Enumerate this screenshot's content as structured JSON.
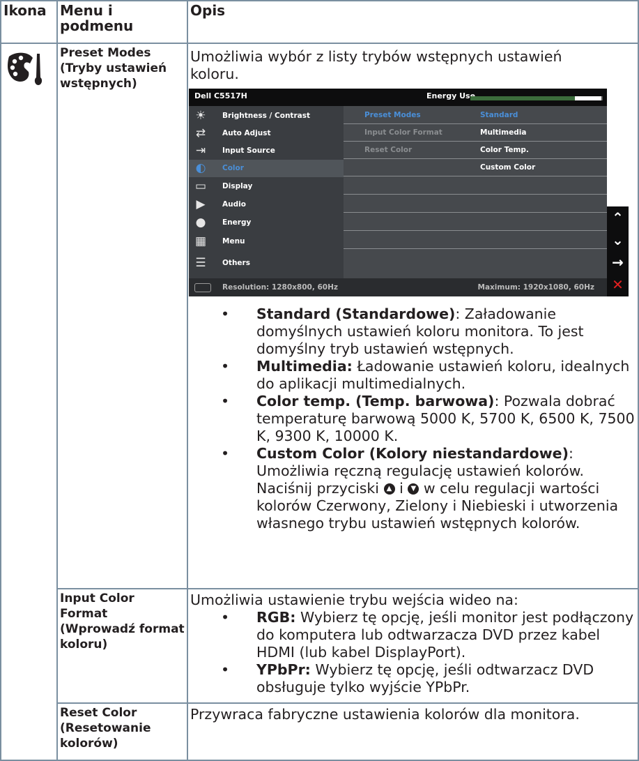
{
  "table": {
    "header": {
      "icon": "Ikona",
      "menu": "Menu i podmenu",
      "desc": "Opis"
    }
  },
  "rows": [
    {
      "icon": "color-palette-icon",
      "menu": "Preset Modes (Tryby ustawień wstępnych)",
      "intro": "Umożliwia wybór z listy trybów wstępnych ustawień koloru.",
      "bullets": [
        {
          "bold": "Standard (Standardowe)",
          "text": ": Załadowanie domyślnych ustawień koloru monitora. To jest domyślny tryb ustawień wstępnych."
        },
        {
          "bold": "Multimedia:",
          "text": " Ładowanie ustawień koloru, idealnych do aplikacji multimedialnych."
        },
        {
          "bold": "Color temp. (Temp. barwowa)",
          "text": ": Pozwala dobrać temperaturę barwową 5000 K, 5700 K, 6500 K, 7500 K, 9300 K, 10000 K."
        },
        {
          "bold": "Custom Color (Kolory niestandardowe)",
          "text_a": ": Umożliwia ręczną regulację ustawień kolorów. Naciśnij przyciski",
          "text_b": "i",
          "text_c": "w celu regulacji wartości kolorów Czerwony, Zielony i Niebieski i utworzenia własnego trybu ustawień wstępnych kolorów."
        }
      ]
    },
    {
      "menu": "Input Color Format (Wprowadź format koloru)",
      "intro": "Umożliwia ustawienie trybu wejścia wideo na:",
      "bullets": [
        {
          "bold": "RGB:",
          "text": " Wybierz tę opcję, jeśli monitor jest podłączony do komputera lub odtwarzacza DVD przez kabel HDMI (lub kabel DisplayPort)."
        },
        {
          "bold": "YPbPr:",
          "text": " Wybierz tę opcję, jeśli odtwarzacz DVD obsługuje tylko wyjście YPbPr."
        }
      ]
    },
    {
      "menu": "Reset Color (Resetowanie kolorów)",
      "intro": "Przywraca fabryczne ustawienia kolorów dla monitora."
    }
  ],
  "osd": {
    "title": "Dell C5517H",
    "energy_label": "Energy Use",
    "energy_level": 0.79,
    "menu": [
      {
        "label": "Brightness / Contrast",
        "icon": "sun-icon"
      },
      {
        "label": "Auto Adjust",
        "icon": "auto-adjust-icon"
      },
      {
        "label": "Input Source",
        "icon": "input-source-icon"
      },
      {
        "label": "Color",
        "icon": "color-icon"
      },
      {
        "label": "Display",
        "icon": "display-icon"
      },
      {
        "label": "Audio",
        "icon": "speaker-icon"
      },
      {
        "label": "Energy",
        "icon": "energy-icon"
      },
      {
        "label": "Menu",
        "icon": "menu-icon"
      },
      {
        "label": "Others",
        "icon": "others-icon"
      }
    ],
    "submenu": [
      "Preset Modes",
      "Input Color Format",
      "Reset Color"
    ],
    "options": [
      "Standard",
      "Multimedia",
      "Color Temp.",
      "Custom Color"
    ],
    "resolution": "Resolution: 1280x800, 60Hz",
    "maximum": "Maximum: 1920x1080, 60Hz",
    "side_buttons": [
      "up-arrow-icon",
      "down-arrow-icon",
      "right-arrow-icon",
      "close-icon"
    ],
    "colors": {
      "accent": "#4a8fd8",
      "energy": "#3c6d3c",
      "close": "#e02020"
    }
  }
}
